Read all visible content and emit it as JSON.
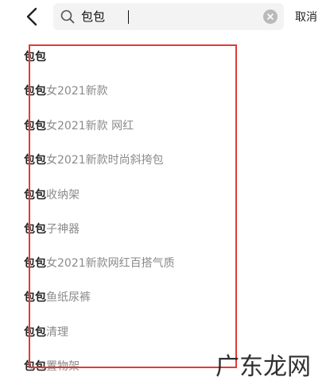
{
  "header": {
    "search_value": "包包",
    "cancel_label": "取消"
  },
  "suggestions": [
    {
      "keyword": "包包",
      "suffix": ""
    },
    {
      "keyword": "包包",
      "suffix": "女2021新款"
    },
    {
      "keyword": "包包",
      "suffix": "女2021新款 网红"
    },
    {
      "keyword": "包包",
      "suffix": "女2021新款时尚斜挎包"
    },
    {
      "keyword": "包包",
      "suffix": "收纳架"
    },
    {
      "keyword": "包包",
      "suffix": "子神器"
    },
    {
      "keyword": "包包",
      "suffix": "女2021新款网红百搭气质"
    },
    {
      "keyword": "包包",
      "suffix": "鱼纸尿裤"
    },
    {
      "keyword": "包包",
      "suffix": "清理"
    },
    {
      "keyword": "包包",
      "suffix": "置物架"
    }
  ],
  "watermark": {
    "logo_text": "广东龙网"
  },
  "colors": {
    "annotation": "#e53935",
    "search_bg": "#f3f3f3",
    "keyword": "#222222",
    "suffix": "#8a8a8a"
  }
}
